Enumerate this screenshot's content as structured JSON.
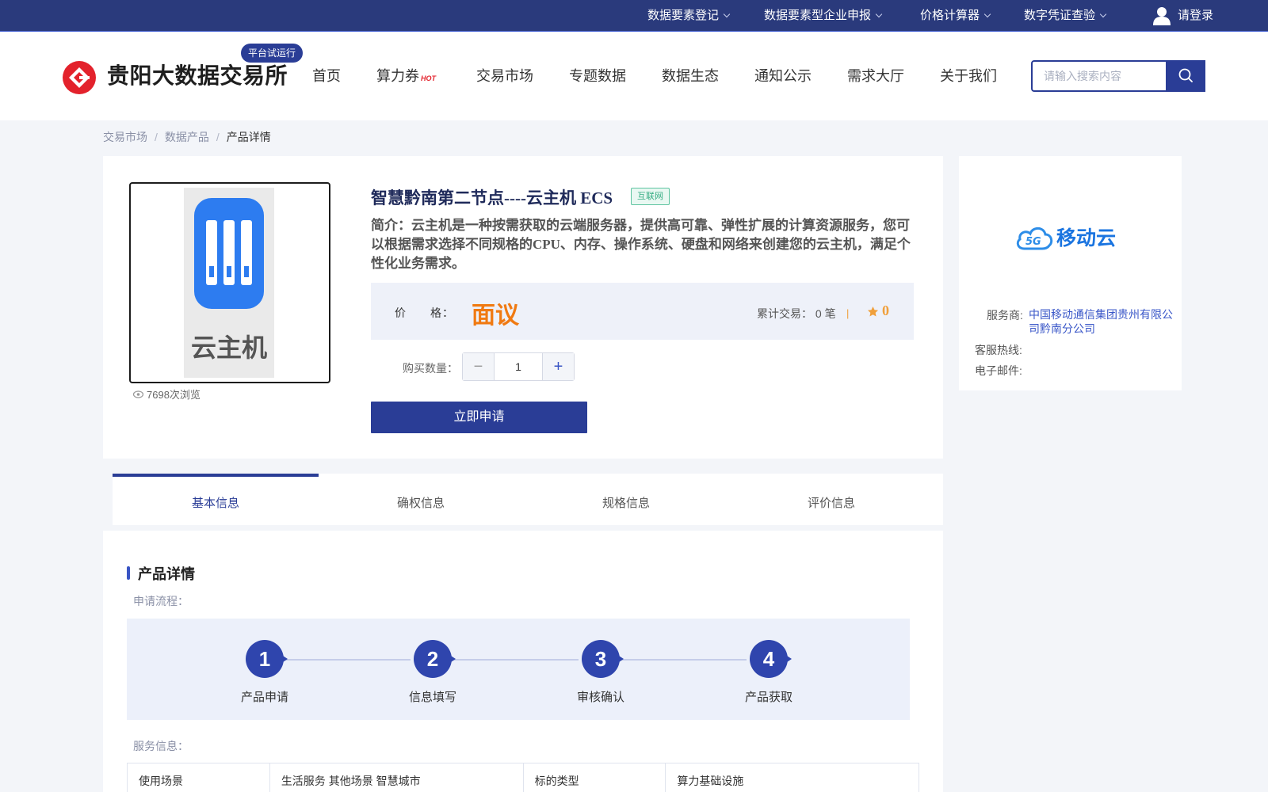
{
  "topbar": {
    "items": [
      {
        "label": "数据要素登记"
      },
      {
        "label": "数据要素型企业申报"
      },
      {
        "label": "价格计算器"
      },
      {
        "label": "数字凭证查验"
      }
    ],
    "login_label": "请登录"
  },
  "header": {
    "logo_text": "贵阳大数据交易所",
    "trial_badge": "平台试运行",
    "nav": [
      {
        "label": "首页"
      },
      {
        "label": "算力券"
      },
      {
        "label": "交易市场"
      },
      {
        "label": "专题数据"
      },
      {
        "label": "数据生态"
      },
      {
        "label": "通知公示"
      },
      {
        "label": "需求大厅"
      },
      {
        "label": "关于我们"
      }
    ],
    "hot_badge": "HOT",
    "search_placeholder": "请输入搜索内容"
  },
  "breadcrumb": [
    "交易市场",
    "数据产品",
    "产品详情"
  ],
  "breadcrumb_sep": "/",
  "product": {
    "image_caption": "云主机",
    "views": "7698次浏览",
    "title": "智慧黔南第二节点----云主机 ECS",
    "tag": "互联网",
    "intro": "简介：云主机是一种按需获取的云端服务器，提供高可靠、弹性扩展的计算资源服务，您可以根据需求选择不同规格的CPU、内存、操作系统、硬盘和网络来创建您的云主机，满足个性化业务需求。",
    "price_label": "价　　格：",
    "price_value": "面议",
    "trades": "累计交易： 0 笔",
    "divider": "|",
    "rating": "0",
    "qty_label": "购买数量：",
    "qty_value": "1",
    "minus": "−",
    "plus": "+",
    "apply_label": "立即申请"
  },
  "provider": {
    "logo_text": "移动云",
    "logo_5g": "5G",
    "service_label": "服务商:",
    "service_value": "中国移动通信集团贵州有限公司黔南分公司",
    "hotline_label": "客服热线:",
    "email_label": "电子邮件:"
  },
  "tabs": [
    {
      "label": "基本信息"
    },
    {
      "label": "确权信息"
    },
    {
      "label": "规格信息"
    },
    {
      "label": "评价信息"
    }
  ],
  "details": {
    "section_title": "产品详情",
    "flow_label": "申请流程：",
    "steps": [
      {
        "num": "1",
        "label": "产品申请"
      },
      {
        "num": "2",
        "label": "信息填写"
      },
      {
        "num": "3",
        "label": "审核确认"
      },
      {
        "num": "4",
        "label": "产品获取"
      }
    ],
    "service_info_label": "服务信息：",
    "table": [
      {
        "k1": "使用场景",
        "v1": "生活服务 其他场景 智慧城市",
        "k2": "标的类型",
        "v2": "算力基础设施"
      }
    ]
  },
  "colors": {
    "brand_navy": "#2a3a7c",
    "primary": "#2a3d96",
    "price_orange": "#f07a12",
    "tag_green": "#37ad84",
    "logo_red": "#e3222c"
  },
  "icons": [
    "user-icon",
    "chevron-down-icon",
    "search-icon",
    "eye-icon",
    "star-icon",
    "logo-mark-icon",
    "cloud-5g-icon",
    "server-icon"
  ]
}
